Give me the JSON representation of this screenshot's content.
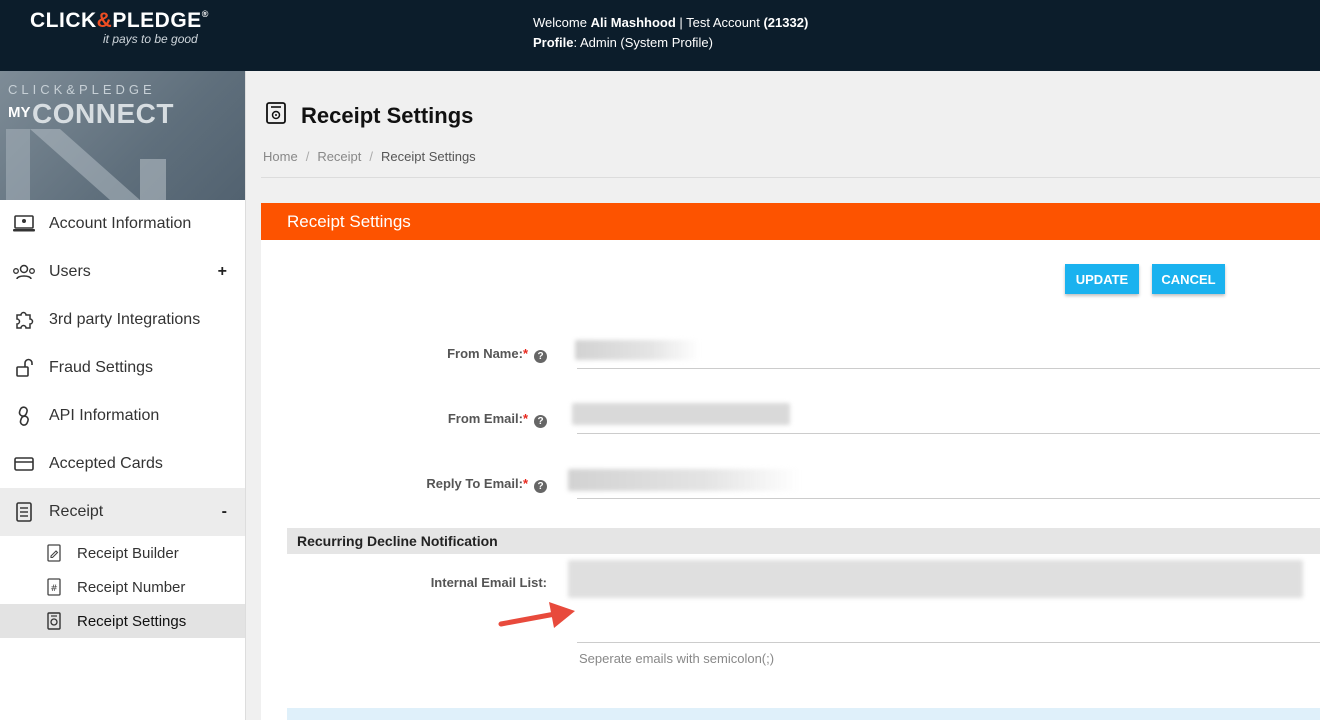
{
  "header": {
    "logo_text_1": "CLICK",
    "logo_amp": "&",
    "logo_text_2": "PLEDGE",
    "logo_reg": "®",
    "logo_tagline": "it pays to be good",
    "welcome_prefix": "Welcome ",
    "user_name": "Ali Mashhood",
    "account_sep": " | Test Account ",
    "account_id": "(21332)",
    "profile_label": "Profile",
    "profile_value": ": Admin (System Profile)"
  },
  "brand": {
    "top": "CLICK&PLEDGE",
    "my": "MY",
    "connect": "CONNECT"
  },
  "sidebar": {
    "items": [
      {
        "label": "Account Information",
        "icon": "laptop-icon"
      },
      {
        "label": "Users",
        "icon": "users-icon",
        "toggle": "+"
      },
      {
        "label": "3rd party Integrations",
        "icon": "puzzle-icon"
      },
      {
        "label": "Fraud Settings",
        "icon": "unlock-icon"
      },
      {
        "label": "API Information",
        "icon": "link-icon"
      },
      {
        "label": "Accepted Cards",
        "icon": "credit-card-icon"
      },
      {
        "label": "Receipt",
        "icon": "receipt-icon",
        "toggle": "-"
      }
    ],
    "sub_items": [
      {
        "label": "Receipt Builder",
        "icon": "edit-document-icon"
      },
      {
        "label": "Receipt Number",
        "icon": "hash-document-icon"
      },
      {
        "label": "Receipt Settings",
        "icon": "settings-document-icon"
      }
    ]
  },
  "page": {
    "title": "Receipt Settings",
    "breadcrumb": [
      "Home",
      "Receipt",
      "Receipt Settings"
    ],
    "breadcrumb_sep": "/"
  },
  "panel": {
    "title": "Receipt Settings",
    "update_label": "UPDATE",
    "cancel_label": "CANCEL",
    "fields": {
      "from_name_label": "From Name:",
      "from_email_label": "From Email:",
      "reply_to_label": "Reply To Email:",
      "required_mark": "*",
      "help_glyph": "?"
    },
    "section_title": "Recurring Decline Notification",
    "internal_email_label": "Internal Email List:",
    "hint": "Seperate emails with semicolon(;)"
  },
  "colors": {
    "topbar": "#0c1d2b",
    "accent_orange": "#fd5300",
    "button_blue": "#1ab2ef",
    "required_red": "#e8261c",
    "arrow_red": "#e84a3c"
  }
}
